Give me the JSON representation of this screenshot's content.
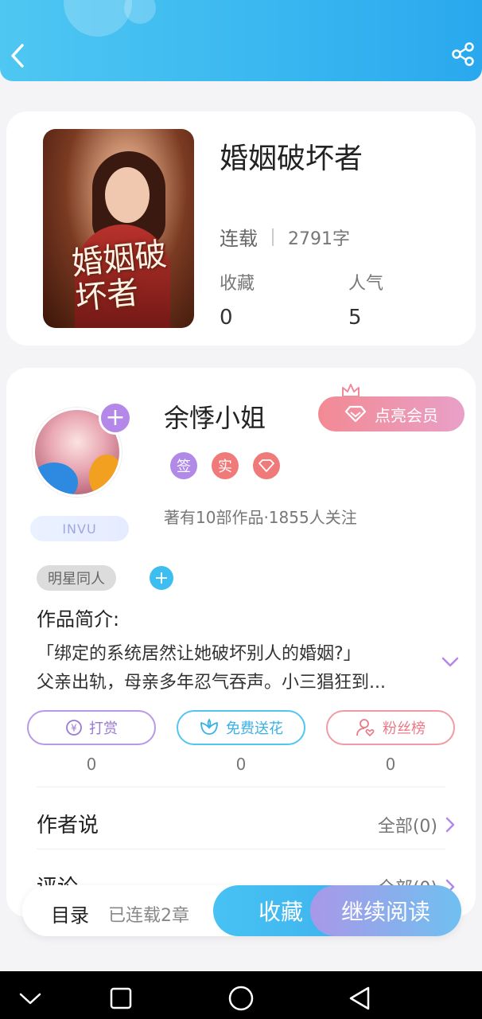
{
  "book": {
    "title": "婚姻破坏者",
    "cover_text": "婚姻破坏者",
    "status": "连载",
    "word_count": "2791字",
    "favorites_label": "收藏",
    "favorites_value": "0",
    "popularity_label": "人气",
    "popularity_value": "5"
  },
  "author": {
    "name": "余悸小姐",
    "vip_label": "点亮会员",
    "invu_label": "INVU",
    "badges": [
      "签",
      "实"
    ],
    "meta": "著有10部作品·1855人关注",
    "add_icon": "plus-icon"
  },
  "tags": [
    "明星同人"
  ],
  "intro": {
    "title": "作品简介:",
    "line1": "「绑定的系统居然让她破坏别人的婚姻?」",
    "line2": "父亲出轨，母亲多年忍气吞声。小三猖狂到..."
  },
  "actions": {
    "tip_label": "打赏",
    "tip_count": "0",
    "flower_label": "免费送花",
    "flower_count": "0",
    "fans_label": "粉丝榜",
    "fans_count": "0"
  },
  "author_says": {
    "title": "作者说",
    "all": "全部(0)"
  },
  "comments": {
    "title": "评论",
    "all": "全部(0)"
  },
  "bottom": {
    "toc": "目录",
    "chapters": "已连载2章",
    "collect": "收藏",
    "continue": "继续阅读"
  },
  "colors": {
    "header": "#38b6f0",
    "purple": "#b388e8",
    "pink": "#f28a93",
    "blue": "#3ebdf1"
  }
}
